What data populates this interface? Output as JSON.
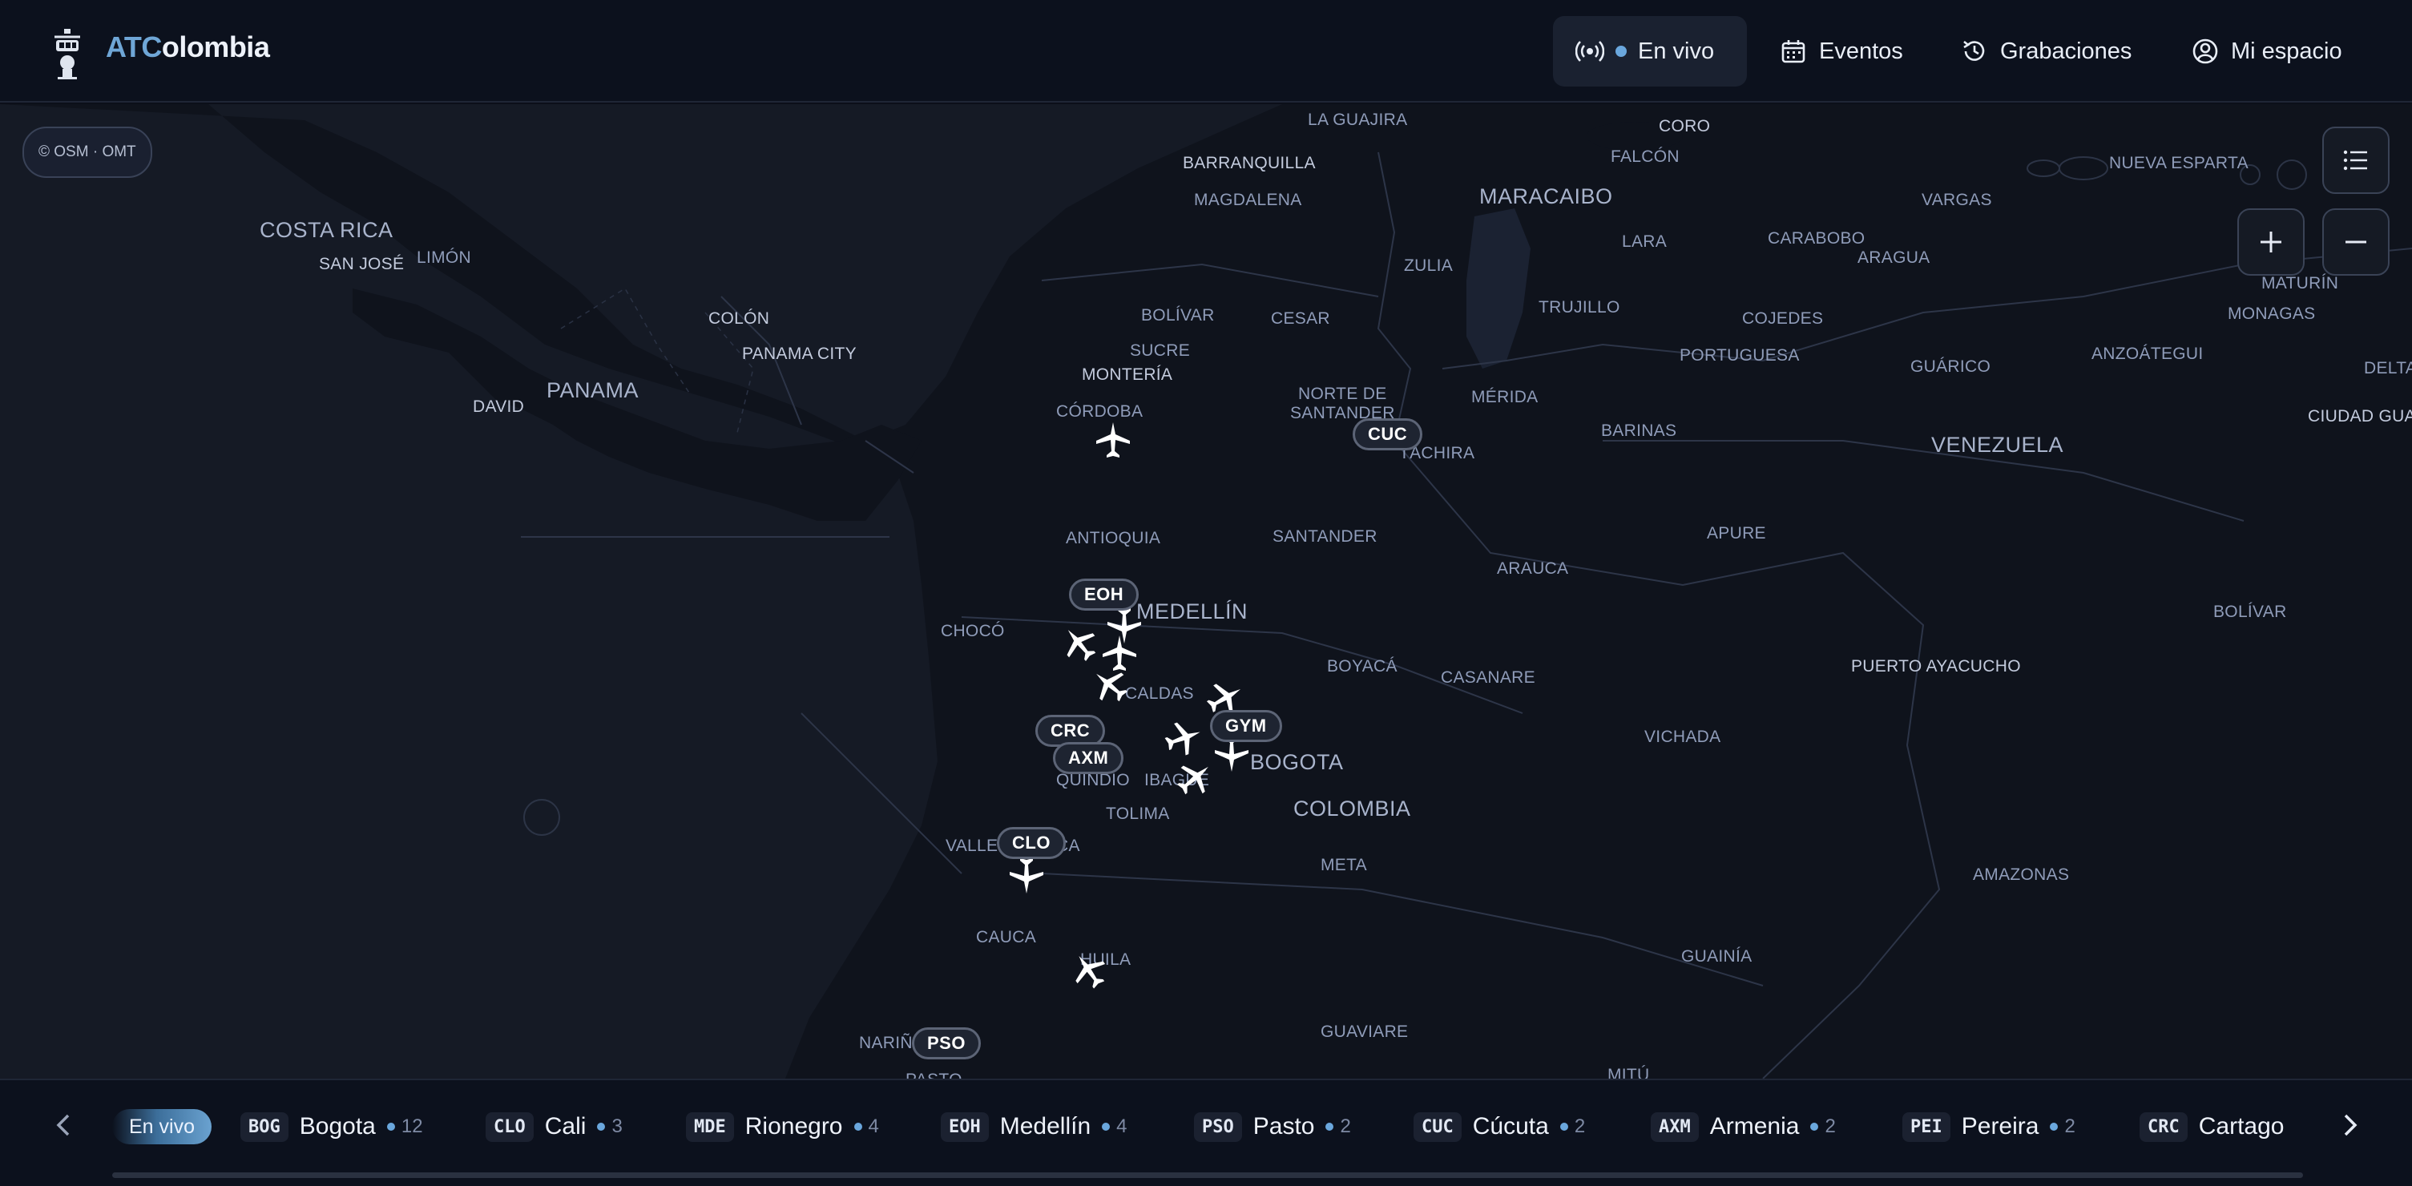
{
  "brand": {
    "part1": "ATC",
    "part2": "olombia"
  },
  "nav": [
    {
      "label": "En vivo",
      "icon": "broadcast-icon",
      "active": true
    },
    {
      "label": "Eventos",
      "icon": "calendar-icon"
    },
    {
      "label": "Grabaciones",
      "icon": "history-icon"
    },
    {
      "label": "Mi espacio",
      "icon": "user-circle-icon"
    }
  ],
  "map": {
    "attribution": "© OSM · OMT",
    "labels": [
      "LA GUAJIRA",
      "CORO",
      "BARRANQUILLA",
      "FALCÓN",
      "MAGDALENA",
      "MARACAIBO",
      "NUEVA ESPARTA",
      "VARGAS",
      "LARA",
      "CARABOBO",
      "ARAGUA",
      "MATURÍN",
      "MONAGAS",
      "ZULIA",
      "TRUJILLO",
      "COJEDES",
      "GUÁRICO",
      "ANZOÁTEGUI",
      "DELTA",
      "CIUDAD GUAY",
      "COSTA RICA",
      "SAN JOSÉ",
      "LIMÓN",
      "COLÓN",
      "PANAMA CITY",
      "PANAMA",
      "DAVID",
      "BOLÍVAR",
      "CESAR",
      "SUCRE",
      "MONTERÍA",
      "CÓRDOBA",
      "NORTE DE",
      "SANTANDER",
      "MÉRIDA",
      "TÁCHIRA",
      "BARINAS",
      "PORTUGUESA",
      "VENEZUELA",
      "ANTIOQUIA",
      "SANTANDER",
      "APURE",
      "ARAUCA",
      "MEDELLÍN",
      "CHOCÓ",
      "BOYACÁ",
      "CASANARE",
      "BOLÍVAR",
      "PUERTO AYACUCHO",
      "CALDAS",
      "QUINDÍO",
      "IBAGUÉ",
      "BOGOTA",
      "COLOMBIA",
      "TOLIMA",
      "VICHADA",
      "VALLE",
      "CA",
      "META",
      "CAUCA",
      "AMAZONAS",
      "HUILA",
      "GUAINÍA",
      "NARIÑO",
      "GUAVIARE",
      "MITÚ",
      "PASTO"
    ],
    "airports": [
      "CUC",
      "EOH",
      "CRC",
      "AXM",
      "GYM",
      "CLO",
      "PSO"
    ],
    "controls": {
      "list": "list-icon",
      "zoom_in": "plus-icon",
      "zoom_out": "minus-icon"
    }
  },
  "bottom": {
    "live_label": "En vivo",
    "stations": [
      {
        "code": "BOG",
        "city": "Bogota",
        "count": "12"
      },
      {
        "code": "CLO",
        "city": "Cali",
        "count": "3"
      },
      {
        "code": "MDE",
        "city": "Rionegro",
        "count": "4"
      },
      {
        "code": "EOH",
        "city": "Medellín",
        "count": "4"
      },
      {
        "code": "PSO",
        "city": "Pasto",
        "count": "2"
      },
      {
        "code": "CUC",
        "city": "Cúcuta",
        "count": "2"
      },
      {
        "code": "AXM",
        "city": "Armenia",
        "count": "2"
      },
      {
        "code": "PEI",
        "city": "Pereira",
        "count": "2"
      },
      {
        "code": "CRC",
        "city": "Cartago",
        "count": ""
      }
    ]
  },
  "colors": {
    "accent": "#6aa7dd",
    "background": "#0b0f19",
    "map": "#151a25"
  }
}
